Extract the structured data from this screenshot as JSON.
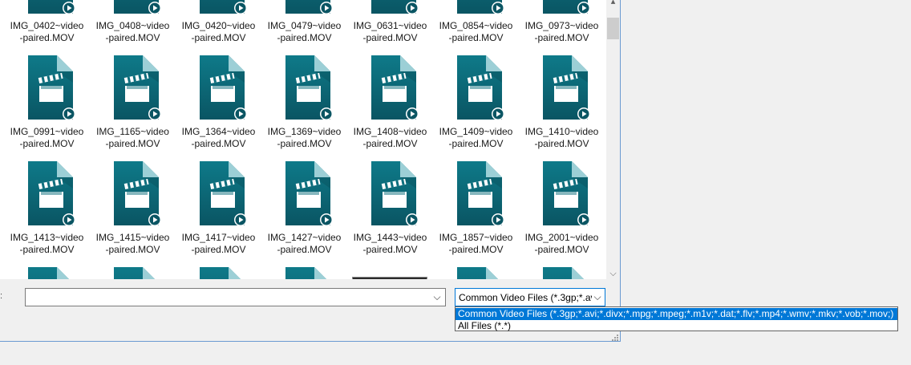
{
  "files_row0": [
    {
      "line1": "IMG_0402~video",
      "line2": "-paired.MOV"
    },
    {
      "line1": "IMG_0408~video",
      "line2": "-paired.MOV"
    },
    {
      "line1": "IMG_0420~video",
      "line2": "-paired.MOV"
    },
    {
      "line1": "IMG_0479~video",
      "line2": "-paired.MOV"
    },
    {
      "line1": "IMG_0631~video",
      "line2": "-paired.MOV"
    },
    {
      "line1": "IMG_0854~video",
      "line2": "-paired.MOV"
    },
    {
      "line1": "IMG_0973~video",
      "line2": "-paired.MOV"
    }
  ],
  "files_row1": [
    {
      "line1": "IMG_0991~video",
      "line2": "-paired.MOV"
    },
    {
      "line1": "IMG_1165~video",
      "line2": "-paired.MOV"
    },
    {
      "line1": "IMG_1364~video",
      "line2": "-paired.MOV"
    },
    {
      "line1": "IMG_1369~video",
      "line2": "-paired.MOV"
    },
    {
      "line1": "IMG_1408~video",
      "line2": "-paired.MOV"
    },
    {
      "line1": "IMG_1409~video",
      "line2": "-paired.MOV"
    },
    {
      "line1": "IMG_1410~video",
      "line2": "-paired.MOV"
    }
  ],
  "files_row2": [
    {
      "line1": "IMG_1413~video",
      "line2": "-paired.MOV"
    },
    {
      "line1": "IMG_1415~video",
      "line2": "-paired.MOV"
    },
    {
      "line1": "IMG_1417~video",
      "line2": "-paired.MOV"
    },
    {
      "line1": "IMG_1427~video",
      "line2": "-paired.MOV"
    },
    {
      "line1": "IMG_1443~video",
      "line2": "-paired.MOV"
    },
    {
      "line1": "IMG_1857~video",
      "line2": "-paired.MOV"
    },
    {
      "line1": "IMG_2001~video",
      "line2": "-paired.MOV"
    }
  ],
  "icons": {
    "video_file": "video-file-icon",
    "dropdown_arrow": "chevron-down-icon",
    "scroll_up": "scroll-up-arrow",
    "scroll_down": "scroll-down-arrow"
  },
  "filename_input": {
    "value": "",
    "label": ":"
  },
  "filetype": {
    "selected": "Common Video Files (*.3gp;*.avi;*.divx;*.mpg;*.mpeg;*.m1v;*.dat;*.flv;*.mp4;*.wmv;*.mkv;*.vob;*.mov;)",
    "options": [
      "Common Video Files (*.3gp;*.avi;*.divx;*.mpg;*.mpeg;*.m1v;*.dat;*.flv;*.mp4;*.wmv;*.mkv;*.vob;*.mov;)",
      "All Files (*.*)"
    ]
  },
  "colors": {
    "icon_teal": "#0e6f7e",
    "icon_teal_dark": "#0a5563",
    "selection": "#0078d7"
  }
}
